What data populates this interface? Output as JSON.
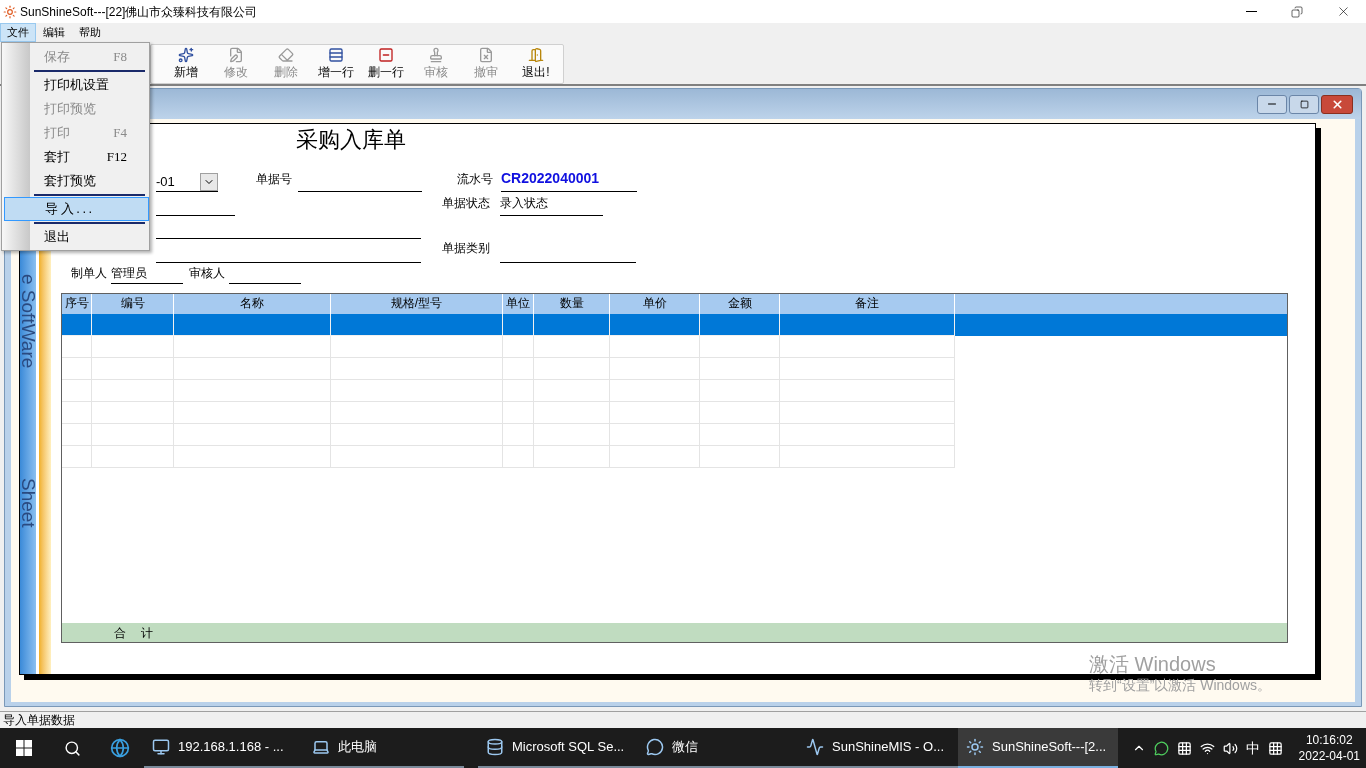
{
  "window": {
    "title": "SunShineSoft---[22]佛山市众臻科技有限公司"
  },
  "menu_bar": [
    {
      "label": "文件",
      "selected": true
    },
    {
      "label": "编辑",
      "selected": false
    },
    {
      "label": "帮助",
      "selected": false
    }
  ],
  "file_menu": [
    {
      "kind": "item",
      "label": "保存",
      "shortcut": "F8",
      "disabled": true,
      "selected": false
    },
    {
      "kind": "separator"
    },
    {
      "kind": "item",
      "label": "打印机设置",
      "disabled": false,
      "selected": false
    },
    {
      "kind": "item",
      "label": "打印预览",
      "disabled": true,
      "selected": false
    },
    {
      "kind": "item",
      "label": "打印",
      "shortcut": "F4",
      "disabled": true,
      "selected": false
    },
    {
      "kind": "item",
      "label": "套打",
      "shortcut": "F12",
      "disabled": false,
      "selected": false
    },
    {
      "kind": "item",
      "label": "套打预览",
      "disabled": false,
      "selected": false
    },
    {
      "kind": "separator"
    },
    {
      "kind": "item",
      "label": "导入...",
      "disabled": false,
      "selected": true
    },
    {
      "kind": "separator"
    },
    {
      "kind": "item",
      "label": "退出",
      "disabled": false,
      "selected": false
    }
  ],
  "toolbar": [
    {
      "kind": "add",
      "label": "新增",
      "disabled": false
    },
    {
      "kind": "edit",
      "label": "修改",
      "disabled": true
    },
    {
      "kind": "delete",
      "label": "删除",
      "disabled": true
    },
    {
      "kind": "add-row",
      "label": "增一行",
      "disabled": false
    },
    {
      "kind": "delete-row",
      "label": "删一行",
      "disabled": false
    },
    {
      "kind": "review",
      "label": "审核",
      "disabled": true
    },
    {
      "kind": "unreview",
      "label": "撤审",
      "disabled": true
    },
    {
      "kind": "exit",
      "label": "退出!",
      "disabled": false
    }
  ],
  "side_strip": [
    "e SoftWare",
    "Sheet"
  ],
  "document": {
    "title": "采购入库单",
    "date_value": "-01",
    "bill_no": {
      "label": "单据号"
    },
    "serial_no": {
      "label": "流水号",
      "value": "CR2022040001"
    },
    "status": {
      "label": "单据状态",
      "value": "录入状态"
    },
    "category": {
      "label": "单据类别"
    },
    "creator": {
      "label": "制单人",
      "value": "管理员"
    },
    "reviewer": {
      "label": "审核人"
    }
  },
  "table": {
    "columns": [
      "序号",
      "编号",
      "名称",
      "规格/型号",
      "单位",
      "数量",
      "单价",
      "金额",
      "备注"
    ],
    "rows": [
      {
        "selected": true
      },
      {
        "selected": false
      },
      {
        "selected": false
      },
      {
        "selected": false
      },
      {
        "selected": false
      },
      {
        "selected": false
      },
      {
        "selected": false
      }
    ],
    "total_label": "合 计"
  },
  "activation_notice": [
    "激活 Windows",
    "转到“设置”以激活 Windows。"
  ],
  "status_bar": "导入单据数据",
  "taskbar": {
    "items": [
      {
        "kind": "remote",
        "label": "192.168.1.168 - ...",
        "selected": false
      },
      {
        "kind": "computer",
        "label": "此电脑",
        "selected": false
      },
      {
        "kind": "database",
        "label": "Microsoft SQL Se...",
        "selected": false
      },
      {
        "kind": "chat",
        "label": "微信",
        "selected": false
      },
      {
        "kind": "runner",
        "label": "SunShineMIS - O...",
        "selected": false
      },
      {
        "kind": "app",
        "label": "SunShineSoft---[2...",
        "selected": true
      }
    ],
    "ime": "中",
    "time": "10:16:02",
    "date": "2022-04-01"
  }
}
